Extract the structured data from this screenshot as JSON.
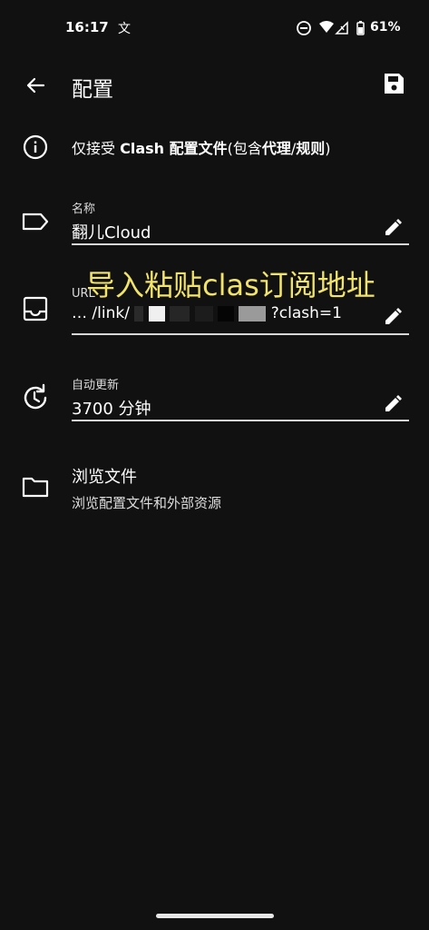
{
  "status_bar": {
    "time": "16:17",
    "lang_indicator": "文",
    "battery": "61%",
    "icons": [
      "do-not-disturb-icon",
      "wifi-icon",
      "signal-icon",
      "battery-icon"
    ]
  },
  "appbar": {
    "title": "配置",
    "back_icon": "arrow-back-icon",
    "save_icon": "save-icon"
  },
  "info": {
    "prefix": "仅接受 ",
    "bold1": "Clash 配置文件",
    "middle": "(包含",
    "bold2": "代理",
    "sep": "/",
    "bold3": "规则",
    "suffix": ")"
  },
  "name_field": {
    "label": "名称",
    "value": "翻儿Cloud"
  },
  "overlay_banner": "导入粘贴clas订阅地址",
  "url_field": {
    "label": "URL",
    "value_start": "…   /link/",
    "value_end": "?clash=1"
  },
  "auto_update_field": {
    "label": "自动更新",
    "value": "3700 分钟"
  },
  "browse": {
    "title": "浏览文件",
    "subtitle": "浏览配置文件和外部资源"
  },
  "colors": {
    "background": "#111111",
    "text": "#ffffff",
    "banner": "#f2e46a",
    "divider": "#d7d7d7"
  }
}
